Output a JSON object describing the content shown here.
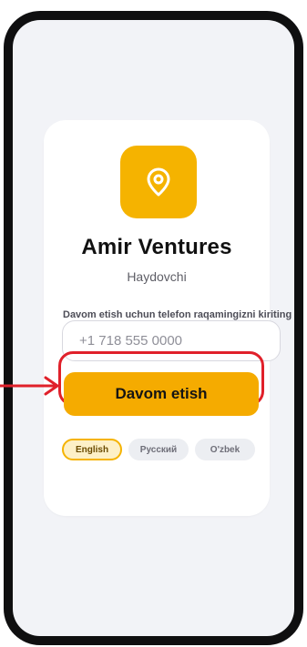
{
  "app": {
    "title": "Amir Ventures",
    "subtitle": "Haydovchi",
    "logo_icon": "location-pin-icon",
    "brand_color": "#f5b300"
  },
  "login": {
    "phone_label": "Davom etish uchun telefon raqamingizni kiriting",
    "phone_placeholder": "+1 718 555 0000",
    "phone_value": "",
    "continue_label": "Davom etish"
  },
  "languages": [
    {
      "label": "English",
      "selected": true
    },
    {
      "label": "Русский",
      "selected": false
    },
    {
      "label": "O'zbek",
      "selected": false
    }
  ],
  "annotation": {
    "highlight_color": "#e0202a",
    "arrow_icon": "right-arrow-icon"
  }
}
